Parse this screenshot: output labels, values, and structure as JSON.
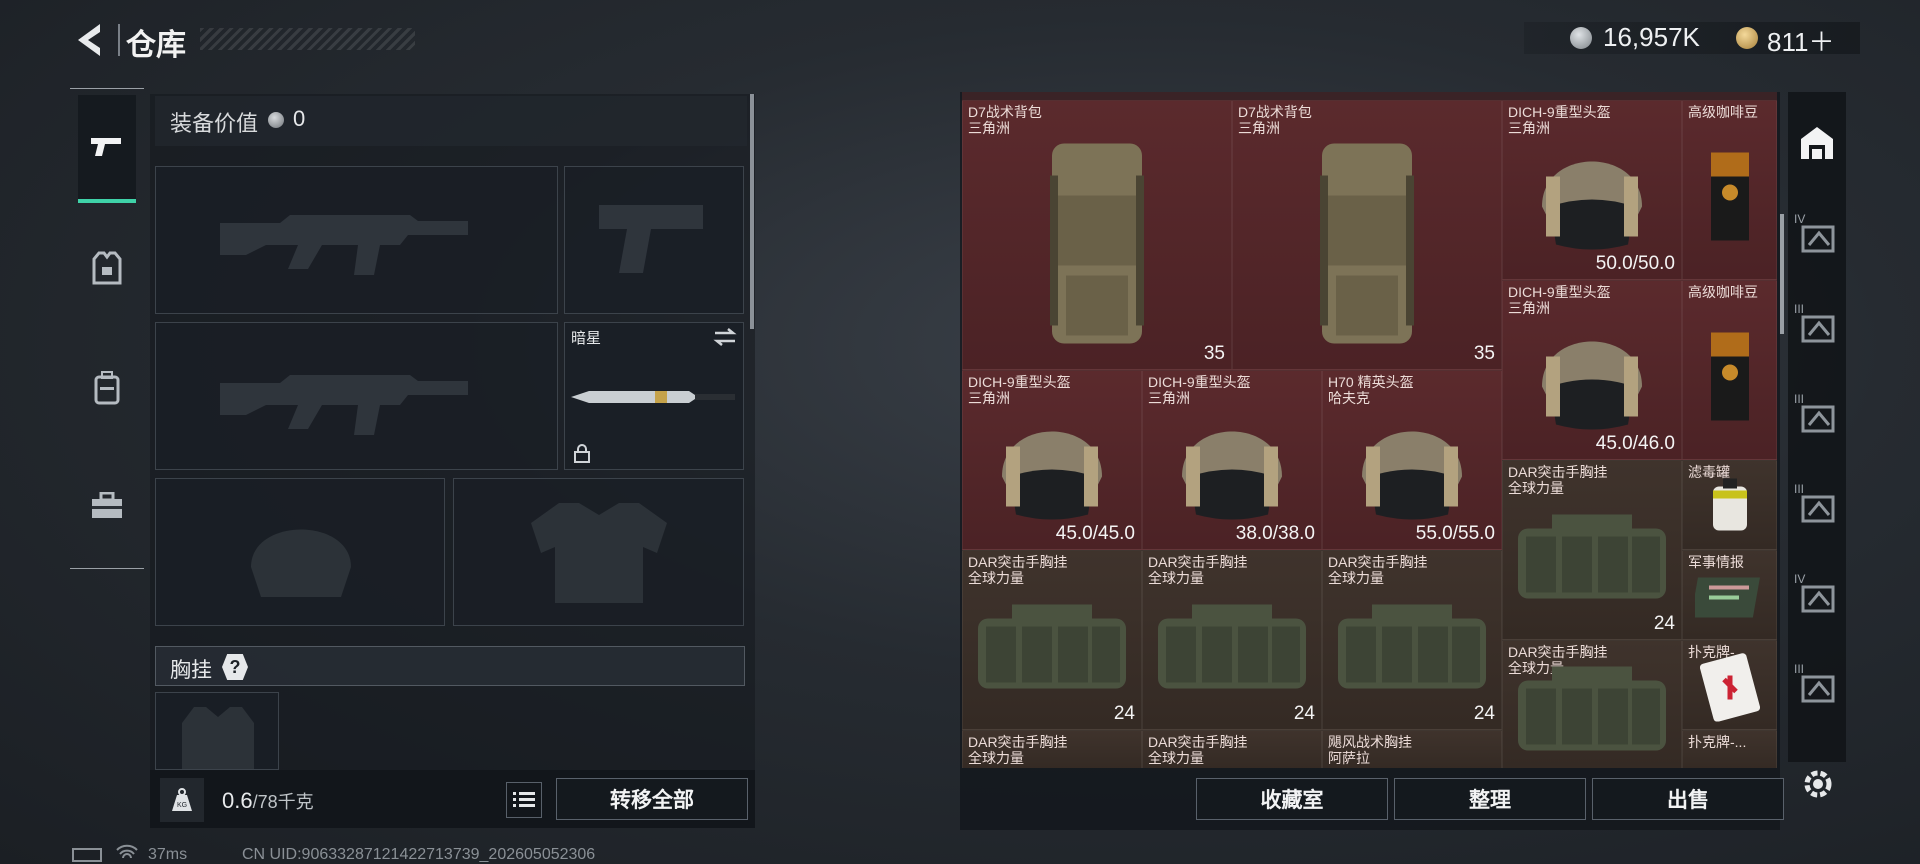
{
  "header": {
    "title": "仓库",
    "currency_silver": "16,957K",
    "currency_gold": "811＋"
  },
  "left_nav": [
    {
      "icon": "pistol-icon",
      "active": true
    },
    {
      "icon": "armor-vest-icon",
      "active": false
    },
    {
      "icon": "backpack-icon",
      "active": false
    },
    {
      "icon": "toolbox-icon",
      "active": false
    }
  ],
  "equipment": {
    "value_label": "装备价值",
    "value": "0",
    "melee_slot_label": "暗星",
    "rig_label": "胸挂",
    "rig_help": "?",
    "weight_value": "0.6",
    "weight_unit": "/78千克",
    "transfer_all": "转移全部"
  },
  "status": {
    "ping": "37ms",
    "uid": "CN UID:90633287121422713739_202605052306"
  },
  "warehouse": {
    "items": [
      {
        "name": "D7战术背包",
        "sub": "三角洲",
        "stat": "35",
        "stat_type": "capacity",
        "color": "red"
      },
      {
        "name": "D7战术背包",
        "sub": "三角洲",
        "stat": "35",
        "stat_type": "capacity",
        "color": "red"
      },
      {
        "name": "DICH-9重型头盔",
        "sub": "三角洲",
        "stat": "50.0/50.0",
        "stat_type": "durability",
        "color": "red"
      },
      {
        "name": "高级咖啡豆",
        "sub": "",
        "stat": "",
        "color": "red"
      },
      {
        "name": "DICH-9重型头盔",
        "sub": "三角洲",
        "stat": "45.0/46.0",
        "stat_type": "durability",
        "color": "red"
      },
      {
        "name": "高级咖啡豆",
        "sub": "",
        "stat": "",
        "color": "red"
      },
      {
        "name": "DICH-9重型头盔",
        "sub": "三角洲",
        "stat": "45.0/45.0",
        "stat_type": "durability",
        "color": "red"
      },
      {
        "name": "DICH-9重型头盔",
        "sub": "三角洲",
        "stat": "38.0/38.0",
        "stat_type": "durability",
        "color": "red"
      },
      {
        "name": "H70 精英头盔",
        "sub": "哈夫克",
        "stat": "55.0/55.0",
        "stat_type": "durability",
        "color": "red"
      },
      {
        "name": "DAR突击手胸挂",
        "sub": "全球力量",
        "stat": "24",
        "stat_type": "capacity",
        "color": "brown"
      },
      {
        "name": "滤毒罐",
        "sub": "",
        "stat": "",
        "color": "brown"
      },
      {
        "name": "军事情报",
        "sub": "",
        "stat": "",
        "color": "brown"
      },
      {
        "name": "DAR突击手胸挂",
        "sub": "全球力量",
        "stat": "24",
        "stat_type": "capacity",
        "color": "brown"
      },
      {
        "name": "DAR突击手胸挂",
        "sub": "全球力量",
        "stat": "24",
        "stat_type": "capacity",
        "color": "brown"
      },
      {
        "name": "DAR突击手胸挂",
        "sub": "全球力量",
        "stat": "24",
        "stat_type": "capacity",
        "color": "brown"
      },
      {
        "name": "DAR突击手胸挂",
        "sub": "全球力量",
        "stat": "",
        "color": "brown"
      },
      {
        "name": "扑克牌-...",
        "sub": "",
        "stat": "",
        "color": "brown"
      },
      {
        "name": "DAR突击手胸挂",
        "sub": "全球力量",
        "stat": "",
        "color": "brown"
      },
      {
        "name": "DAR突击手胸挂",
        "sub": "全球力量",
        "stat": "",
        "color": "brown"
      },
      {
        "name": "飓风战术胸挂",
        "sub": "阿萨拉",
        "stat": "",
        "color": "brown"
      },
      {
        "name": "扑克牌-...",
        "sub": "",
        "stat": "",
        "color": "brown"
      }
    ],
    "buttons": {
      "collection": "收藏室",
      "sort": "整理",
      "sell": "出售"
    },
    "rail_tiers": [
      "IV",
      "III",
      "III",
      "III",
      "IV",
      "III"
    ]
  },
  "colors": {
    "accent": "#3fd2a8",
    "rare_red": "#5b2a2d",
    "common_brown": "#3f332c"
  }
}
